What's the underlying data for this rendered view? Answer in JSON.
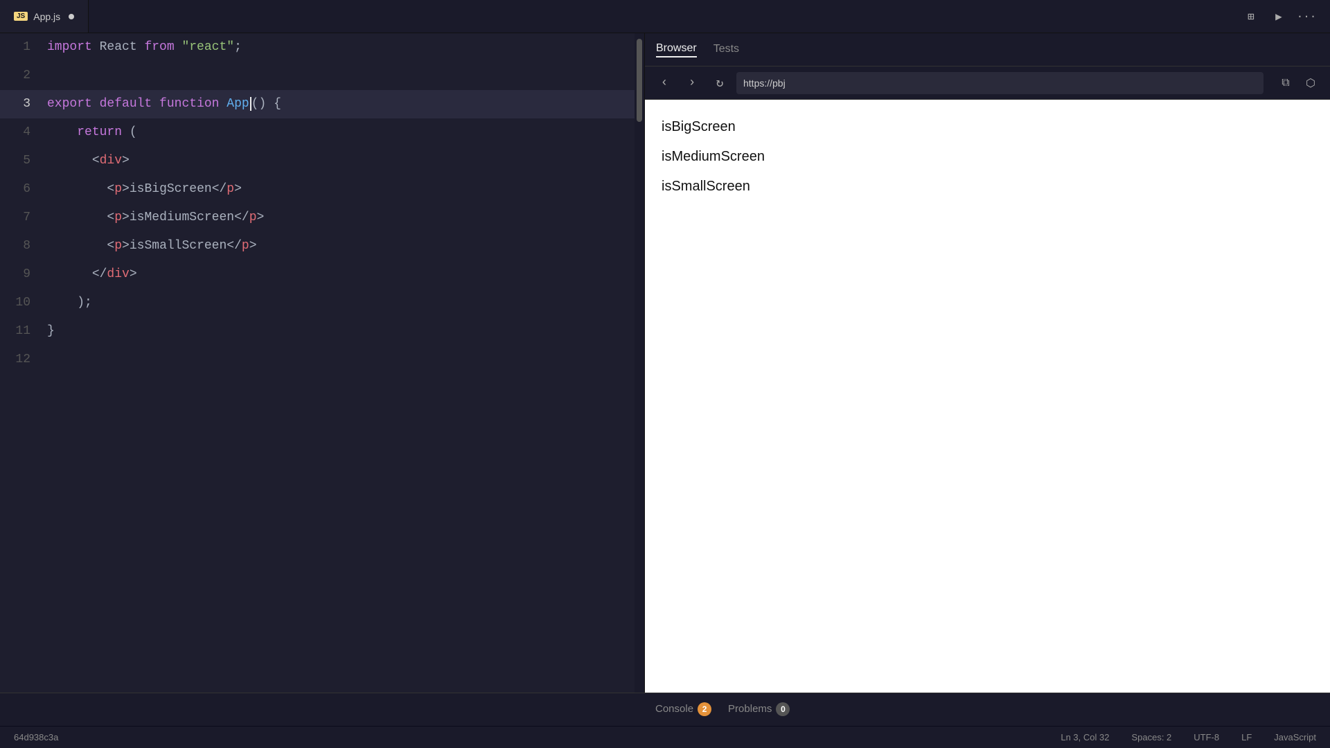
{
  "tabBar": {
    "tab": {
      "jsBadge": "JS",
      "fileName": "App.js",
      "hasUnsavedDot": true
    },
    "actions": {
      "layoutIcon": "⊞",
      "playIcon": "▶",
      "moreIcon": "···"
    }
  },
  "editor": {
    "lines": [
      {
        "num": 1,
        "tokens": [
          {
            "t": "kw-import",
            "v": "import "
          },
          {
            "t": "plain",
            "v": "React "
          },
          {
            "t": "kw-from",
            "v": "from "
          },
          {
            "t": "str",
            "v": "\"react\""
          },
          {
            "t": "plain",
            "v": ";"
          }
        ]
      },
      {
        "num": 2,
        "tokens": []
      },
      {
        "num": 3,
        "tokens": [
          {
            "t": "kw-export",
            "v": "export "
          },
          {
            "t": "kw-default",
            "v": "default "
          },
          {
            "t": "kw-function",
            "v": "function "
          },
          {
            "t": "fn-name",
            "v": "App"
          },
          {
            "t": "plain",
            "v": "() {"
          }
        ],
        "active": true
      },
      {
        "num": 4,
        "tokens": [
          {
            "t": "plain",
            "v": "    "
          },
          {
            "t": "kw-return",
            "v": "return "
          },
          {
            "t": "plain",
            "v": "("
          }
        ]
      },
      {
        "num": 5,
        "tokens": [
          {
            "t": "plain",
            "v": "      "
          },
          {
            "t": "tag-bracket",
            "v": "<"
          },
          {
            "t": "tag-name",
            "v": "div"
          },
          {
            "t": "tag-bracket",
            "v": ">"
          }
        ]
      },
      {
        "num": 6,
        "tokens": [
          {
            "t": "plain",
            "v": "        "
          },
          {
            "t": "tag-bracket",
            "v": "<"
          },
          {
            "t": "tag-name",
            "v": "p"
          },
          {
            "t": "tag-bracket",
            "v": ">"
          },
          {
            "t": "plain",
            "v": "isBigScreen"
          },
          {
            "t": "tag-bracket",
            "v": "</"
          },
          {
            "t": "tag-name",
            "v": "p"
          },
          {
            "t": "tag-bracket",
            "v": ">"
          }
        ]
      },
      {
        "num": 7,
        "tokens": [
          {
            "t": "plain",
            "v": "        "
          },
          {
            "t": "tag-bracket",
            "v": "<"
          },
          {
            "t": "tag-name",
            "v": "p"
          },
          {
            "t": "tag-bracket",
            "v": ">"
          },
          {
            "t": "plain",
            "v": "isMediumScreen"
          },
          {
            "t": "tag-bracket",
            "v": "</"
          },
          {
            "t": "tag-name",
            "v": "p"
          },
          {
            "t": "tag-bracket",
            "v": ">"
          }
        ]
      },
      {
        "num": 8,
        "tokens": [
          {
            "t": "plain",
            "v": "        "
          },
          {
            "t": "tag-bracket",
            "v": "<"
          },
          {
            "t": "tag-name",
            "v": "p"
          },
          {
            "t": "tag-bracket",
            "v": ">"
          },
          {
            "t": "plain",
            "v": "isSmallScreen"
          },
          {
            "t": "tag-bracket",
            "v": "</"
          },
          {
            "t": "tag-name",
            "v": "p"
          },
          {
            "t": "tag-bracket",
            "v": ">"
          }
        ]
      },
      {
        "num": 9,
        "tokens": [
          {
            "t": "plain",
            "v": "      "
          },
          {
            "t": "tag-bracket",
            "v": "</"
          },
          {
            "t": "tag-name",
            "v": "div"
          },
          {
            "t": "tag-bracket",
            "v": ">"
          }
        ]
      },
      {
        "num": 10,
        "tokens": [
          {
            "t": "plain",
            "v": "    );"
          }
        ]
      },
      {
        "num": 11,
        "tokens": [
          {
            "t": "plain",
            "v": "}"
          }
        ]
      },
      {
        "num": 12,
        "tokens": []
      }
    ]
  },
  "browser": {
    "tabs": [
      {
        "label": "Browser",
        "active": true
      },
      {
        "label": "Tests",
        "active": false
      }
    ],
    "toolbar": {
      "backDisabled": false,
      "forwardDisabled": false,
      "url": "https://pbj",
      "copyIcon": "⧉",
      "openExternalIcon": "⬡"
    },
    "viewport": {
      "items": [
        "isBigScreen",
        "isMediumScreen",
        "isSmallScreen"
      ]
    }
  },
  "bottomBar": {
    "tabs": [
      {
        "label": "Console",
        "badge": "2",
        "badgeColor": "orange",
        "active": false
      },
      {
        "label": "Problems",
        "badge": "0",
        "badgeColor": "gray",
        "active": false
      }
    ]
  },
  "statusBar": {
    "gitHash": "64d938c3a",
    "position": "Ln 3, Col 32",
    "spaces": "Spaces: 2",
    "encoding": "UTF-8",
    "lineEnding": "LF",
    "language": "JavaScript"
  }
}
